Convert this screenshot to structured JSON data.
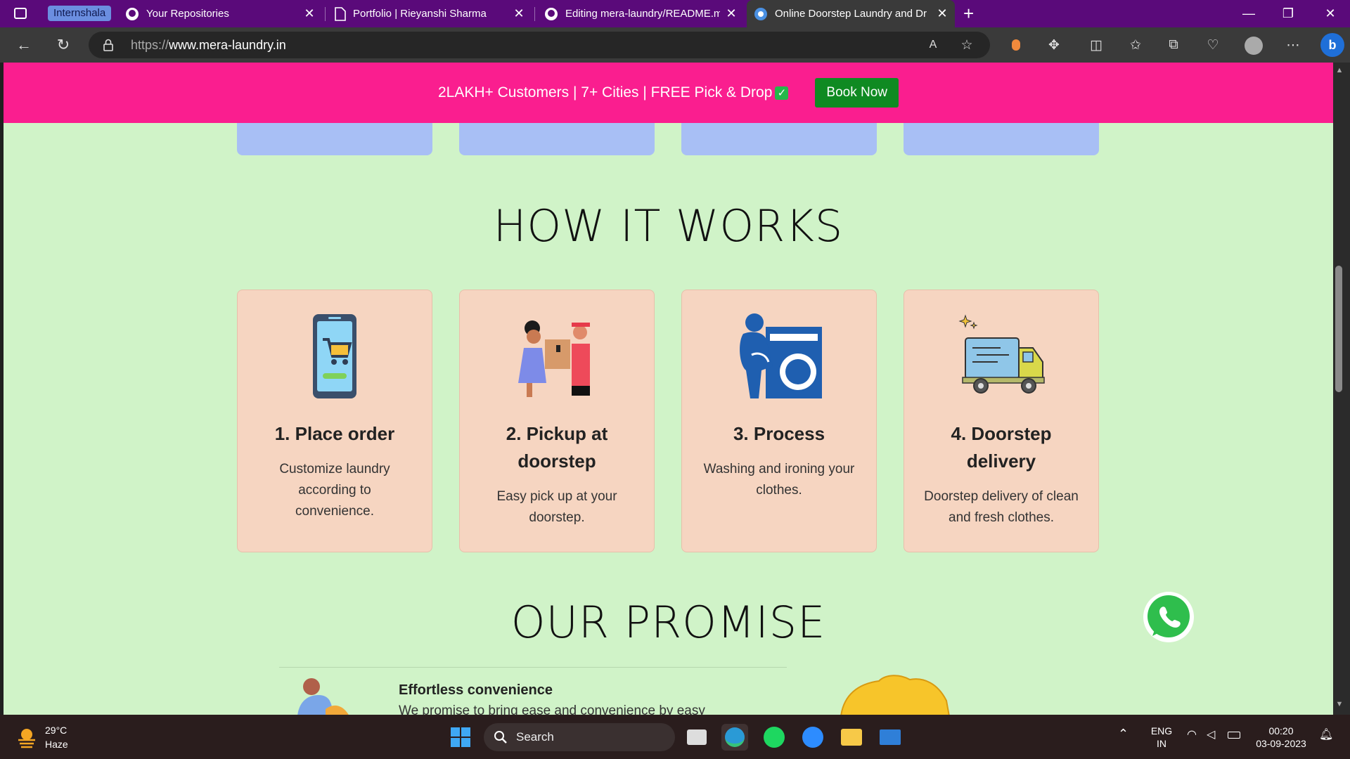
{
  "browser": {
    "tab_group": "Internshala",
    "tabs": [
      {
        "title": "Your Repositories",
        "icon": "github-icon"
      },
      {
        "title": "Portfolio | Rieyanshi Sharma",
        "icon": "document-icon"
      },
      {
        "title": "Editing mera-laundry/README.m",
        "icon": "github-icon"
      },
      {
        "title": "Online Doorstep Laundry and Dr",
        "icon": "laundry-site-icon",
        "active": true
      }
    ],
    "url_scheme": "https://",
    "url_host": "www.mera-laundry.in"
  },
  "banner": {
    "text": "2LAKH+ Customers | 7+ Cities | FREE Pick & Drop",
    "check": "✓",
    "cta": "Book Now"
  },
  "how_it_works": {
    "title": "HOW IT WORKS",
    "steps": [
      {
        "title": "1. Place order",
        "desc": "Customize laundry according to convenience.",
        "icon": "shopping-cart-phone-icon"
      },
      {
        "title": "2. Pickup at doorstep",
        "desc": "Easy pick up at your doorstep.",
        "icon": "pickup-handover-icon"
      },
      {
        "title": "3. Process",
        "desc": "Washing and ironing your clothes.",
        "icon": "washing-machine-icon"
      },
      {
        "title": "4. Doorstep delivery",
        "desc": "Doorstep delivery of clean and fresh clothes.",
        "icon": "delivery-truck-icon"
      }
    ]
  },
  "promise": {
    "title": "OUR PROMISE",
    "item_title": "Effortless convenience",
    "item_desc": "We promise to bring ease and convenience by easy"
  },
  "taskbar": {
    "temp": "29°C",
    "condition": "Haze",
    "search": "Search",
    "lang1": "ENG",
    "lang2": "IN",
    "time": "00:20",
    "date": "03-09-2023"
  },
  "colors": {
    "banner": "#fa1e8f",
    "page_bg": "#d0f3c8",
    "card": "#f6d5c1",
    "cta": "#0f8a22",
    "tab_bar": "#5a0a7a"
  }
}
